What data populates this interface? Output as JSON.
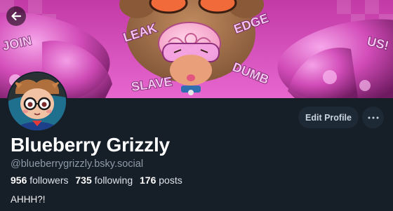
{
  "banner": {
    "words": [
      "JOIN",
      "LEAK",
      "EDGE",
      "SLAVE",
      "DUMB",
      "US!"
    ]
  },
  "profile": {
    "display_name": "Blueberry Grizzly",
    "handle": "@blueberrygrizzly.bsky.social",
    "followers_count": "956",
    "followers_label": "followers",
    "following_count": "735",
    "following_label": "following",
    "posts_count": "176",
    "posts_label": "posts",
    "bio": "AHHH?!"
  },
  "actions": {
    "edit_profile_label": "Edit Profile"
  },
  "icons": {
    "back": "arrow-left-icon",
    "more": "ellipsis-icon"
  },
  "colors": {
    "background": "#161e27",
    "button_bg": "#1e2936",
    "handle_text": "#8d9bab",
    "banner_pink": "#e05bc7"
  }
}
